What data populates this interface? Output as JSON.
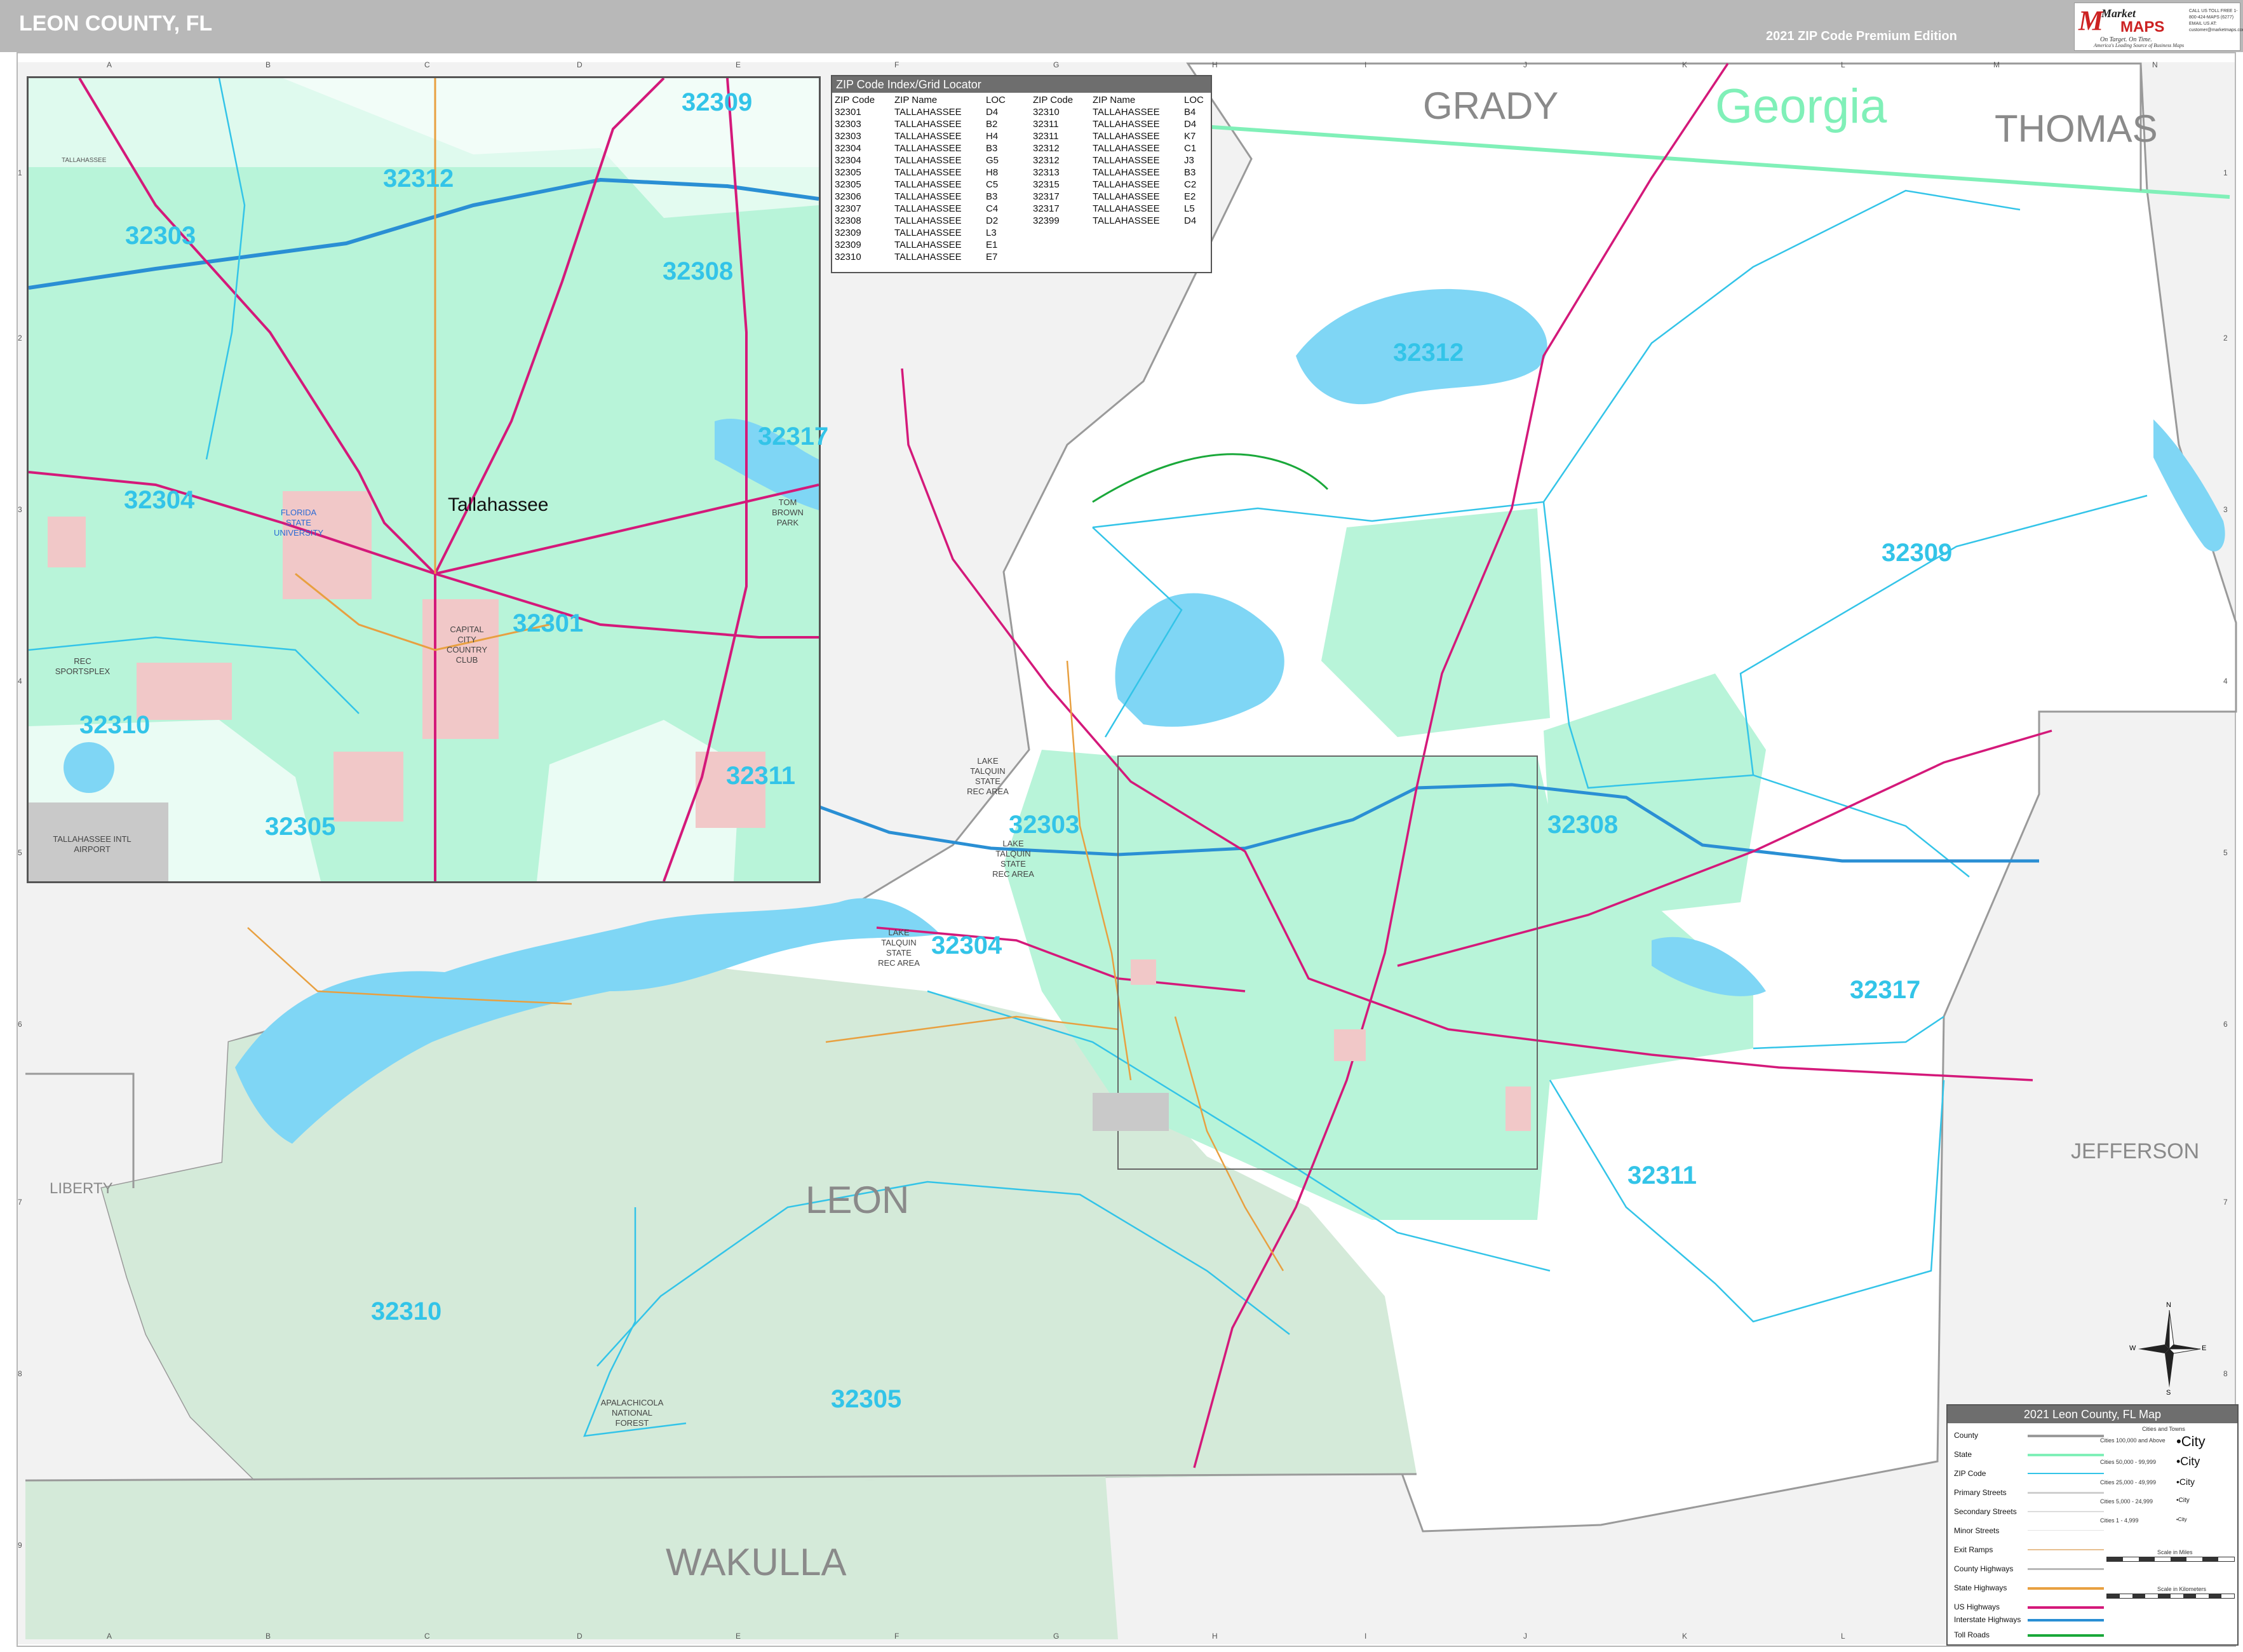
{
  "header": {
    "title": "LEON COUNTY, FL",
    "edition": "2021 ZIP Code Premium Edition",
    "logo_market": "Market",
    "logo_maps": "MAPS",
    "logo_tagline": "On Target. On Time.",
    "logo_subtagline": "America's Leading Source of Business Maps",
    "logo_contact": "CALL US TOLL FREE 1-800-424-MAPS (6277) EMAIL US AT: customer@marketmaps.com"
  },
  "grid": {
    "columns": [
      "A",
      "B",
      "C",
      "D",
      "E",
      "F",
      "G",
      "H",
      "I",
      "J",
      "K",
      "L",
      "M",
      "N"
    ],
    "rows": [
      "1",
      "2",
      "3",
      "4",
      "5",
      "6",
      "7",
      "8",
      "9"
    ]
  },
  "colors": {
    "zip_city_fill": "#b8f4d9",
    "forest_fill": "#d4ead9",
    "water": "#7fd6f5",
    "zip_line": "#33c4e8",
    "interstate": "#2a8fd4",
    "us_highway": "#d4197a",
    "state_highway": "#e8a040",
    "county_line": "#9a9a9a",
    "state_line": "#80f0b8",
    "toll_road": "#1aa83a"
  },
  "labels": {
    "counties": {
      "grady": "GRADY",
      "thomas": "THOMAS",
      "jefferson": "JEFFERSON",
      "liberty": "LIBERTY",
      "leon": "LEON",
      "wakulla": "WAKULLA"
    },
    "state": "Georgia",
    "zips_main": {
      "z32312": "32312",
      "z32309": "32309",
      "z32303": "32303",
      "z32308": "32308",
      "z32304": "32304",
      "z32317": "32317",
      "z32311": "32311",
      "z32310": "32310",
      "z32305": "32305"
    },
    "zips_inset": {
      "z32309": "32309",
      "z32312": "32312",
      "z32303": "32303",
      "z32308": "32308",
      "z32317": "32317",
      "z32304": "32304",
      "z32301": "32301",
      "z32310": "32310",
      "z32311": "32311",
      "z32305": "32305"
    },
    "inset_city": "Tallahassee",
    "inset_tag": "TALLAHASSEE",
    "parks": {
      "lake_talquin_1": "LAKE TALQUIN STATE REC AREA",
      "lake_talquin_2": "LAKE TALQUIN STATE REC AREA",
      "lake_talquin_3": "LAKE TALQUIN STATE REC AREA",
      "apalachicola": "APALACHICOLA NATIONAL FOREST",
      "fsu": "FLORIDA STATE UNIVERSITY",
      "capital_city": "CAPITAL CITY COUNTRY CLUB",
      "tom_brown": "TOM BROWN PARK",
      "rec_sportsplex": "REC SPORTSPLEX",
      "airport": "TALLAHASSEE INTL AIRPORT"
    }
  },
  "zip_index": {
    "title": "ZIP Code Index/Grid Locator",
    "headers": [
      "ZIP Code",
      "ZIP Name",
      "LOC"
    ],
    "left": [
      [
        "32301",
        "TALLAHASSEE",
        "D4"
      ],
      [
        "32303",
        "TALLAHASSEE",
        "B2"
      ],
      [
        "32303",
        "TALLAHASSEE",
        "H4"
      ],
      [
        "32304",
        "TALLAHASSEE",
        "B3"
      ],
      [
        "32304",
        "TALLAHASSEE",
        "G5"
      ],
      [
        "32305",
        "TALLAHASSEE",
        "H8"
      ],
      [
        "32305",
        "TALLAHASSEE",
        "C5"
      ],
      [
        "32306",
        "TALLAHASSEE",
        "B3"
      ],
      [
        "32307",
        "TALLAHASSEE",
        "C4"
      ],
      [
        "32308",
        "TALLAHASSEE",
        "D2"
      ],
      [
        "32309",
        "TALLAHASSEE",
        "L3"
      ],
      [
        "32309",
        "TALLAHASSEE",
        "E1"
      ],
      [
        "32310",
        "TALLAHASSEE",
        "E7"
      ]
    ],
    "right": [
      [
        "32310",
        "TALLAHASSEE",
        "B4"
      ],
      [
        "32311",
        "TALLAHASSEE",
        "D4"
      ],
      [
        "32311",
        "TALLAHASSEE",
        "K7"
      ],
      [
        "32312",
        "TALLAHASSEE",
        "C1"
      ],
      [
        "32312",
        "TALLAHASSEE",
        "J3"
      ],
      [
        "32313",
        "TALLAHASSEE",
        "B3"
      ],
      [
        "32315",
        "TALLAHASSEE",
        "C2"
      ],
      [
        "32317",
        "TALLAHASSEE",
        "E2"
      ],
      [
        "32317",
        "TALLAHASSEE",
        "L5"
      ],
      [
        "32399",
        "TALLAHASSEE",
        "D4"
      ]
    ]
  },
  "legend": {
    "title": "2021 Leon County, FL Map",
    "cities_head": "Cities and Towns",
    "items": [
      "County",
      "State",
      "ZIP Code",
      "Primary Streets",
      "Secondary Streets",
      "Minor Streets",
      "Exit Ramps",
      "County Highways",
      "State Highways",
      "US Highways",
      "Interstate Highways",
      "Toll Roads"
    ],
    "city_ranges": [
      "Cities 100,000 and Above",
      "Cities 50,000 - 99,999",
      "Cities 25,000 - 49,999",
      "Cities 5,000 - 24,999",
      "Cities 1 - 4,999"
    ],
    "city_samples": [
      "•City",
      "•City",
      "•City",
      "•City",
      "•City"
    ],
    "scale_miles": "Scale in Miles",
    "scale_km": "Scale in Kilometers"
  },
  "compass": {
    "n": "N",
    "s": "S",
    "e": "E",
    "w": "W"
  }
}
